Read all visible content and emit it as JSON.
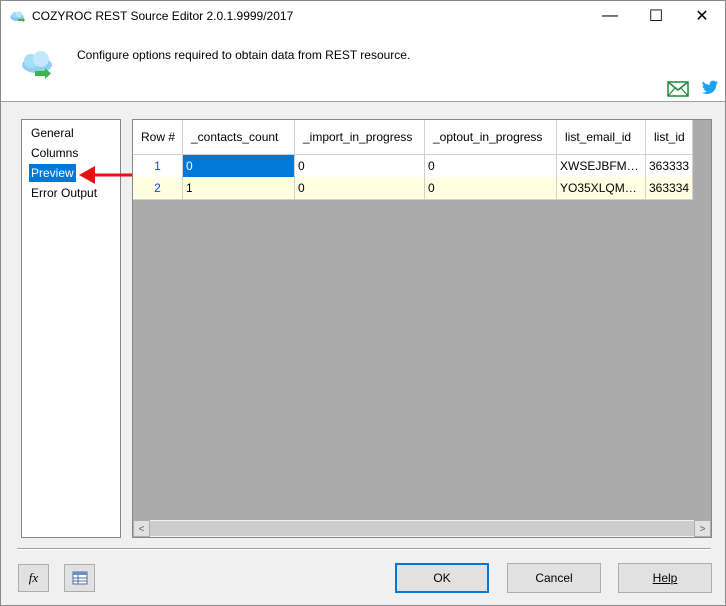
{
  "window": {
    "title": "COZYROC REST Source Editor 2.0.1.9999/2017",
    "minimize_glyph": "—",
    "maximize_glyph": "☐",
    "close_glyph": "✕"
  },
  "header": {
    "description": "Configure options required to obtain data from REST resource."
  },
  "nav": {
    "items": [
      {
        "label": "General",
        "selected": false
      },
      {
        "label": "Columns",
        "selected": false
      },
      {
        "label": "Preview",
        "selected": true
      },
      {
        "label": "Error Output",
        "selected": false
      }
    ]
  },
  "grid": {
    "columns": [
      "Row #",
      "_contacts_count",
      "_import_in_progress",
      "_optout_in_progress",
      "list_email_id",
      "list_id"
    ],
    "rows": [
      [
        "1",
        "0",
        "0",
        "0",
        "XWSEJBFMK7...",
        "363333"
      ],
      [
        "2",
        "1",
        "0",
        "0",
        "YO35XLQMCQ...",
        "363334"
      ]
    ],
    "scroll_left": "<",
    "scroll_right": ">"
  },
  "footer": {
    "fx_label": "fx",
    "ok_label": "OK",
    "cancel_label": "Cancel",
    "help_label": "Help"
  },
  "colors": {
    "selection": "#0078d7",
    "alt_row": "#ffffe1",
    "annotation_arrow": "#e81010"
  }
}
